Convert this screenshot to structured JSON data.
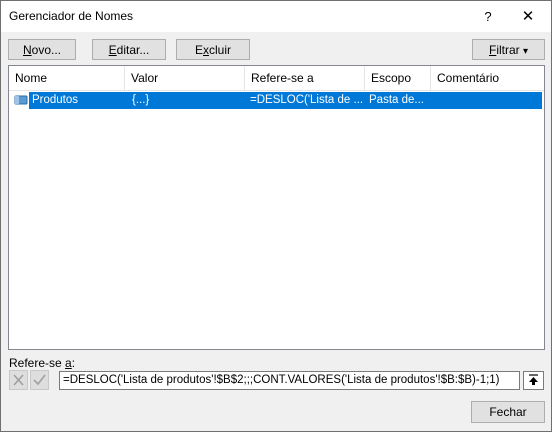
{
  "window": {
    "title": "Gerenciador de Nomes",
    "help_glyph": "?",
    "close_glyph": "✕"
  },
  "toolbar": {
    "novo_pre": "",
    "novo_u": "N",
    "novo_post": "ovo...",
    "editar_pre": "",
    "editar_u": "E",
    "editar_post": "ditar...",
    "excluir_pre": "E",
    "excluir_u": "x",
    "excluir_post": "cluir",
    "filtrar_pre": "",
    "filtrar_u": "F",
    "filtrar_post": "iltrar",
    "filtrar_arrow": "▾"
  },
  "table": {
    "columns": [
      "Nome",
      "Valor",
      "Refere-se a",
      "Escopo",
      "Comentário"
    ],
    "rows": [
      {
        "nome": "Produtos",
        "valor": "{...}",
        "refere": "=DESLOC('Lista de ...",
        "escopo": "Pasta de...",
        "comentario": ""
      }
    ]
  },
  "refers": {
    "label_pre": "Refere-se ",
    "label_u": "a",
    "label_post": ":",
    "value": "=DESLOC('Lista de produtos'!$B$2;;;CONT.VALORES('Lista de produtos'!$B:$B)-1;1)"
  },
  "footer": {
    "close_label": "Fechar"
  }
}
